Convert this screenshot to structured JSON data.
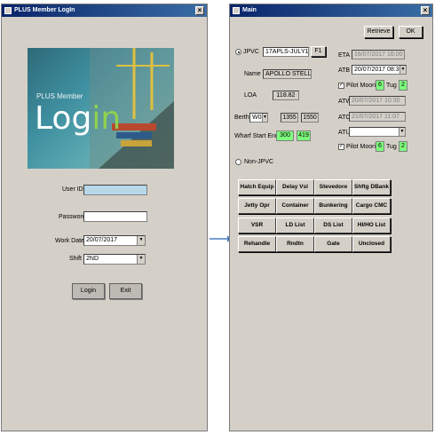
{
  "login": {
    "title": "PLUS Member LogIn",
    "banner_small": "PLUS Member",
    "banner_big_1": "Log",
    "banner_big_2": "in",
    "user_id_label": "User ID",
    "user_id_value": "",
    "password_label": "Password",
    "password_value": "",
    "work_date_label": "Work Date",
    "work_date_value": "20/07/2017",
    "shift_label": "Shift",
    "shift_value": "2ND",
    "login_button": "Login",
    "exit_button": "Exit"
  },
  "main": {
    "title": "Main",
    "retrieve_button": "Retrieve",
    "ok_button": "OK",
    "jpvc_label": "JPVC",
    "jpvc_value": "17APLS-JULY1",
    "f1_button": "F1",
    "name_label": "Name",
    "name_value": "APOLLO STELLA",
    "loa_label": "LOA",
    "loa_value": "118.82",
    "berth_label": "Berth",
    "berth_value": "W08",
    "berth_from": "1355",
    "berth_to": "1550",
    "wharf_label": "Wharf Start End",
    "wharf_start": "300",
    "wharf_end": "419",
    "non_jpvc_label": "Non-JPVC",
    "eta_label": "ETA",
    "eta_value": "16/07/2017 16:00",
    "atb_label": "ATB",
    "atb_value": "20/07/2017 08:30",
    "pilot1_label": "Pilot Moorin",
    "pilot1_value": "6",
    "tug1_label": "Tug",
    "tug1_value": "2",
    "atw_label": "ATW",
    "atw_value": "20/07/2017 10:30",
    "atc_label": "ATC",
    "atc_value": "21/07/2017 11:07",
    "atu_label": "ATU",
    "atu_value": "",
    "pilot2_label": "Pilot Moorin",
    "pilot2_value": "6",
    "tug2_label": "Tug",
    "tug2_value": "2",
    "grid": [
      [
        "Hatch Equip",
        "Delay Vsl",
        "Stevedore",
        "Shftg DBank"
      ],
      [
        "Jetty Opr",
        "Container",
        "Bunkering",
        "Cargo CMC"
      ],
      [
        "VSR",
        "LD List",
        "DS List",
        "HI/HO List"
      ],
      [
        "Rehandle",
        "Rndtn",
        "Gate",
        "Unclosed"
      ]
    ]
  },
  "arrow_icon": "right-arrow-icon",
  "colors": {
    "titlebar": "#0a246a",
    "highlight": "#7dfc7d",
    "window_bg": "#d4d0c8",
    "login_green": "#8fd14f"
  }
}
